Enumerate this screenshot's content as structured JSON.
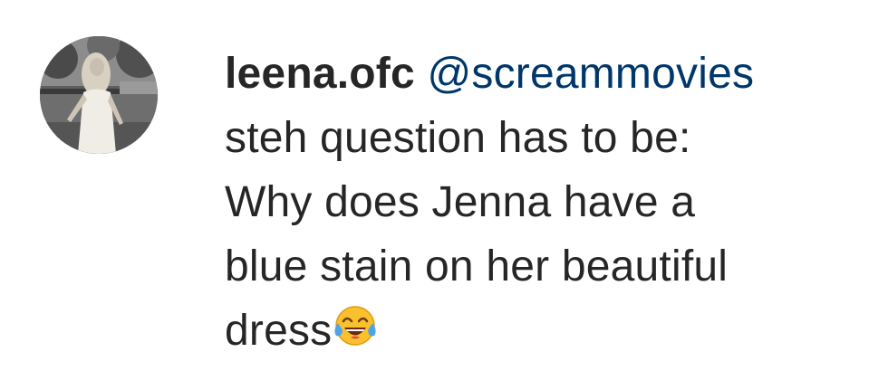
{
  "comment": {
    "username": "leena.ofc",
    "mention": "@screammovies",
    "lines": [
      "steh question has to be:",
      "Why does Jenna have a",
      "blue stain on her beautiful",
      "dress"
    ],
    "emoji": "face-with-tears-of-joy-icon"
  },
  "colors": {
    "text": "#262626",
    "mention": "#00376b",
    "background": "#ffffff"
  }
}
